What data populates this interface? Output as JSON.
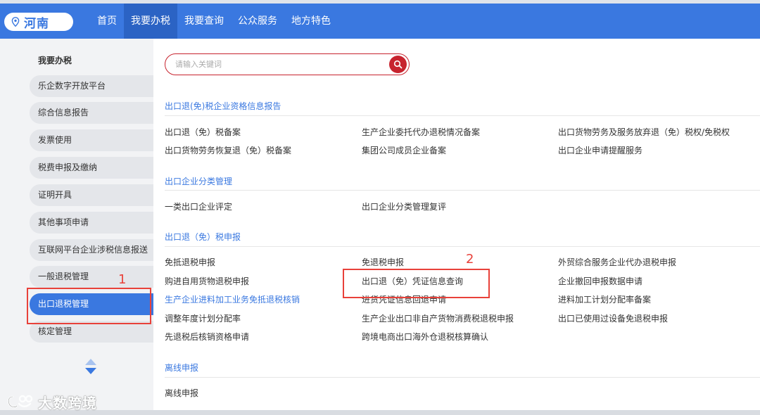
{
  "header": {
    "region": "河南",
    "region_icon": "location-pin-icon",
    "nav": [
      "首页",
      "我要办税",
      "我要查询",
      "公众服务",
      "地方特色"
    ],
    "active_nav": "我要办税",
    "accent_color": "#3a78e0"
  },
  "sidebar": {
    "title": "我要办税",
    "items": [
      "乐企数字开放平台",
      "综合信息报告",
      "发票使用",
      "税费申报及缴纳",
      "证明开具",
      "其他事项申请",
      "互联网平台企业涉税信息报送",
      "一般退税管理",
      "出口退税管理",
      "核定管理"
    ],
    "active_item": "出口退税管理",
    "scroll_icon": "up-down-arrows-icon"
  },
  "search": {
    "placeholder": "请输入关键词",
    "icon": "search-icon",
    "accent_color": "#c7232e"
  },
  "sections": [
    {
      "title": "出口退(免)税企业资格信息报告",
      "links": [
        "出口退（免）税备案",
        "生产企业委托代办退税情况备案",
        "出口货物劳务及服务放弃退（免）税权/免税权",
        "出口货物劳务恢复退（免）税备案",
        "集团公司成员企业备案",
        "出口企业申请提醒服务"
      ]
    },
    {
      "title": "出口企业分类管理",
      "links": [
        "一类出口企业评定",
        "出口企业分类管理复评"
      ]
    },
    {
      "title": "出口退（免）税申报",
      "links": [
        "免抵退税申报",
        "免退税申报",
        "外贸综合服务企业代办退税申报",
        "购进自用货物退税申报",
        "出口退（免）凭证信息查询",
        "企业撤回申报数据申请",
        "生产企业进料加工业务免抵退税核销",
        "进货凭证信息回退申请",
        "进料加工计划分配率备案",
        "调整年度计划分配率",
        "生产企业出口非自产货物消费税退税申报",
        "出口已使用过设备免退税申报",
        "先退税后核销资格申请",
        "跨境电商出口海外仓退税核算确认"
      ]
    },
    {
      "title": "离线申报",
      "links": [
        "离线申报"
      ]
    }
  ],
  "annotations": {
    "label_1": "1",
    "label_2": "2",
    "color": "#e8413a"
  },
  "watermark": {
    "text": "大数跨境",
    "icon": "brand-logo-icon"
  }
}
